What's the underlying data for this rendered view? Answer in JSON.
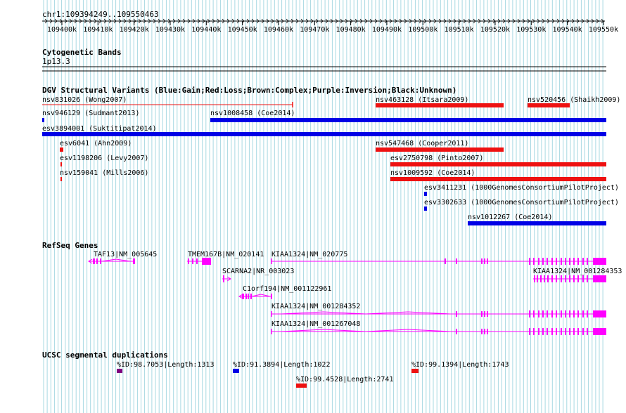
{
  "colors": {
    "grid": "#a7d8e2",
    "gain": "#0000e6",
    "loss": "#ee1111",
    "gene": "#ff00ff",
    "segdup_purple": "#800080",
    "segdup_blue": "#0000e6",
    "segdup_red": "#ee1111"
  },
  "ruler": {
    "region": "chr1:109394249..109550463",
    "ticks": [
      "109400k",
      "109410k",
      "109420k",
      "109430k",
      "109440k",
      "109450k",
      "109460k",
      "109470k",
      "109480k",
      "109490k",
      "109500k",
      "109510k",
      "109520k",
      "109530k",
      "109540k",
      "109550k"
    ]
  },
  "tracks": {
    "cytobands": {
      "title": "Cytogenetic Bands",
      "band": "1p13.3"
    },
    "dgv": {
      "title": "DGV Structural Variants (Blue:Gain;Red:Loss;Brown:Complex;Purple:Inversion;Black:Unknown)",
      "features": [
        {
          "label": "nsv831026 (Wong2007)",
          "type": "loss-line"
        },
        {
          "label": "nsv463128 (Itsara2009)",
          "type": "loss"
        },
        {
          "label": "nsv520456 (Shaikh2009)",
          "type": "loss"
        },
        {
          "label": "nsv946129 (Sudmant2013)",
          "type": "gain"
        },
        {
          "label": "nsv1008458 (Coe2014)",
          "type": "gain"
        },
        {
          "label": "esv3894001 (Suktitipat2014)",
          "type": "gain"
        },
        {
          "label": "esv6041 (Ahn2009)",
          "type": "loss"
        },
        {
          "label": "nsv547468 (Cooper2011)",
          "type": "loss"
        },
        {
          "label": "esv1198206 (Levy2007)",
          "type": "loss"
        },
        {
          "label": "esv2750798 (Pinto2007)",
          "type": "loss"
        },
        {
          "label": "nsv159041 (Mills2006)",
          "type": "loss"
        },
        {
          "label": "nsv1009592 (Coe2014)",
          "type": "loss"
        },
        {
          "label": "esv3411231 (1000GenomesConsortiumPilotProject)",
          "type": "gain"
        },
        {
          "label": "esv3302633 (1000GenomesConsortiumPilotProject)",
          "type": "gain"
        },
        {
          "label": "nsv1012267 (Coe2014)",
          "type": "gain"
        }
      ]
    },
    "refseq": {
      "title": "RefSeq Genes",
      "genes": [
        {
          "label": "TAF13|NM_005645"
        },
        {
          "label": "TMEM167B|NM_020141"
        },
        {
          "label": "KIAA1324|NM_020775"
        },
        {
          "label": "SCARNA2|NR_003023"
        },
        {
          "label": "KIAA1324|NM_001284353"
        },
        {
          "label": "C1orf194|NM_001122961"
        },
        {
          "label": "KIAA1324|NM_001284352"
        },
        {
          "label": "KIAA1324|NM_001267048"
        }
      ]
    },
    "segdups": {
      "title": "UCSC segmental duplications",
      "items": [
        {
          "label": "%ID:98.7053|Length:1313",
          "color": "purple"
        },
        {
          "label": "%ID:91.3894|Length:1022",
          "color": "blue"
        },
        {
          "label": "%ID:99.1394|Length:1743",
          "color": "red"
        },
        {
          "label": "%ID:99.4528|Length:2741",
          "color": "red"
        }
      ]
    }
  }
}
